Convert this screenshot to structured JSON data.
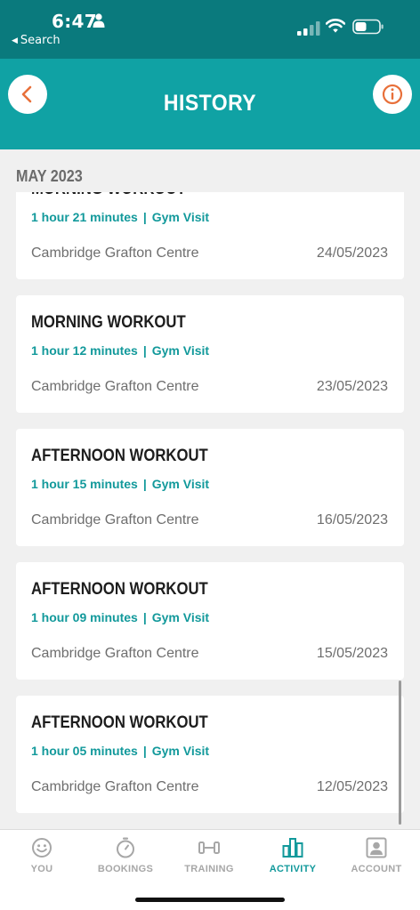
{
  "status_bar": {
    "time": "6:47",
    "back_label": "Search"
  },
  "header": {
    "title": "HISTORY"
  },
  "month_header": "MAY 2023",
  "workouts": [
    {
      "title": "MORNING WORKOUT",
      "duration": "1 hour 21 minutes",
      "separator": "|",
      "type": "Gym Visit",
      "location": "Cambridge Grafton Centre",
      "date": "24/05/2023"
    },
    {
      "title": "MORNING WORKOUT",
      "duration": "1 hour 12 minutes",
      "separator": "|",
      "type": "Gym Visit",
      "location": "Cambridge Grafton Centre",
      "date": "23/05/2023"
    },
    {
      "title": "AFTERNOON WORKOUT",
      "duration": "1 hour 15 minutes",
      "separator": "|",
      "type": "Gym Visit",
      "location": "Cambridge Grafton Centre",
      "date": "16/05/2023"
    },
    {
      "title": "AFTERNOON WORKOUT",
      "duration": "1 hour 09 minutes",
      "separator": "|",
      "type": "Gym Visit",
      "location": "Cambridge Grafton Centre",
      "date": "15/05/2023"
    },
    {
      "title": "AFTERNOON WORKOUT",
      "duration": "1 hour 05 minutes",
      "separator": "|",
      "type": "Gym Visit",
      "location": "Cambridge Grafton Centre",
      "date": "12/05/2023"
    }
  ],
  "tabs": [
    {
      "label": "YOU",
      "icon": "smiley-icon",
      "active": false
    },
    {
      "label": "BOOKINGS",
      "icon": "stopwatch-icon",
      "active": false
    },
    {
      "label": "TRAINING",
      "icon": "dumbbell-icon",
      "active": false
    },
    {
      "label": "ACTIVITY",
      "icon": "bar-chart-icon",
      "active": true
    },
    {
      "label": "ACCOUNT",
      "icon": "account-icon",
      "active": false
    }
  ],
  "colors": {
    "brand_teal": "#10a2a4",
    "status_teal": "#0a7a7d",
    "accent_orange": "#e8703a",
    "meta_teal": "#12999b"
  }
}
